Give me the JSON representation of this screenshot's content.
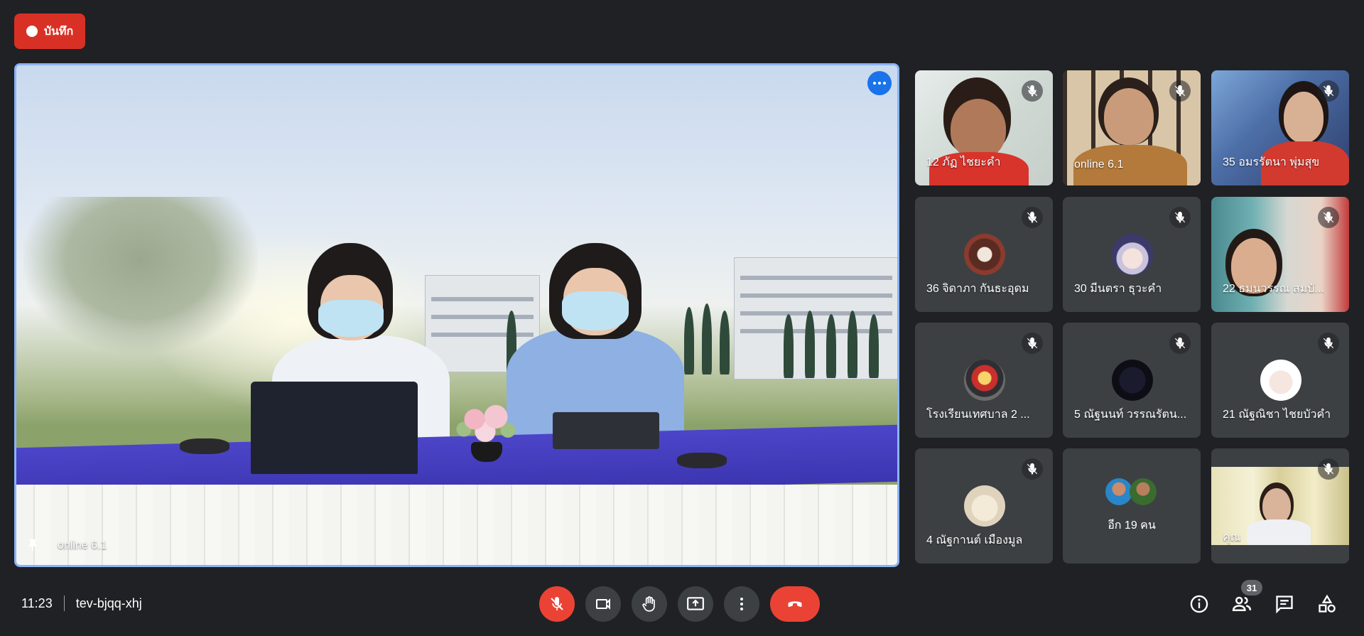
{
  "record_button": {
    "label": "บันทึก"
  },
  "main_video": {
    "name": "online 6.1"
  },
  "tiles": [
    {
      "name": "12 ภัฏ ไชยะคำ",
      "type": "video"
    },
    {
      "name": "online 6.1",
      "type": "video"
    },
    {
      "name": "35 อมรรัตนา พุ่มสุข",
      "type": "video"
    },
    {
      "name": "36 จิดาภา กันธะอุดม",
      "type": "avatar"
    },
    {
      "name": "30 มีนตรา ธุวะคำ",
      "type": "avatar"
    },
    {
      "name": "22 ธมนวรรณ สมบั...",
      "type": "video"
    },
    {
      "name": "โรงเรียนเทศบาล 2 ...",
      "type": "avatar"
    },
    {
      "name": "5 ณัฐนนท์ วรรณรัตน...",
      "type": "avatar"
    },
    {
      "name": "21 ณัฐณิชา ไชยบัวคำ",
      "type": "avatar"
    },
    {
      "name": "4 ณัฐกานต์ เมืองมูล",
      "type": "avatar"
    },
    {
      "name": "อีก 19 คน",
      "type": "others"
    },
    {
      "name": "คุณ",
      "type": "video"
    }
  ],
  "meeting": {
    "time": "11:23",
    "code": "tev-bjqq-xhj"
  },
  "people_count": "31",
  "colors": {
    "background": "#202124",
    "tile": "#3c4043",
    "red": "#ea4335",
    "accent_blue": "#8ab4f8",
    "badge_blue": "#1a73e8"
  },
  "icons": [
    "mic-off-icon",
    "camera-icon",
    "raise-hand-icon",
    "present-icon",
    "more-options-icon",
    "hang-up-icon",
    "info-icon",
    "people-icon",
    "chat-icon",
    "activities-icon",
    "pin-icon"
  ]
}
